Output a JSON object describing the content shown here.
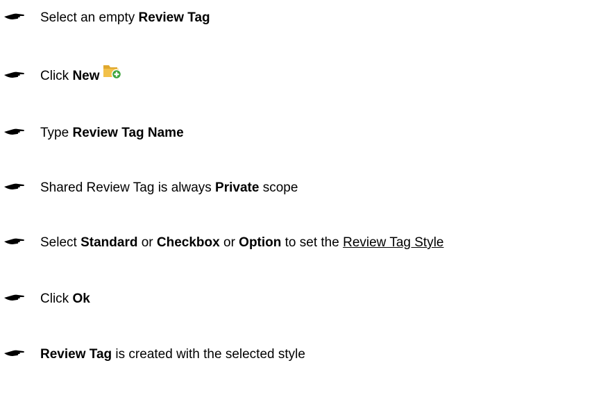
{
  "steps": [
    {
      "parts": [
        "Select an empty ",
        "Review Tag"
      ]
    },
    {
      "parts": [
        "Click ",
        "New"
      ],
      "icon": "folder-add-icon"
    },
    {
      "parts": [
        "Type ",
        "Review Tag Name"
      ]
    },
    {
      "parts": [
        "Shared Review Tag is always ",
        "Private",
        " scope"
      ]
    },
    {
      "parts": [
        "Select ",
        "Standard",
        " or ",
        "Checkbox",
        " or ",
        "Option",
        " to set the ",
        "Review Tag Style"
      ]
    },
    {
      "parts": [
        "Click ",
        "Ok"
      ]
    },
    {
      "parts": [
        "Review Tag",
        " is created with the selected style"
      ]
    }
  ],
  "bullet_icon": "pointing-hand-icon",
  "colors": {
    "text": "#000000",
    "folder": "#f2c14a",
    "plus": "#3aa33a"
  }
}
